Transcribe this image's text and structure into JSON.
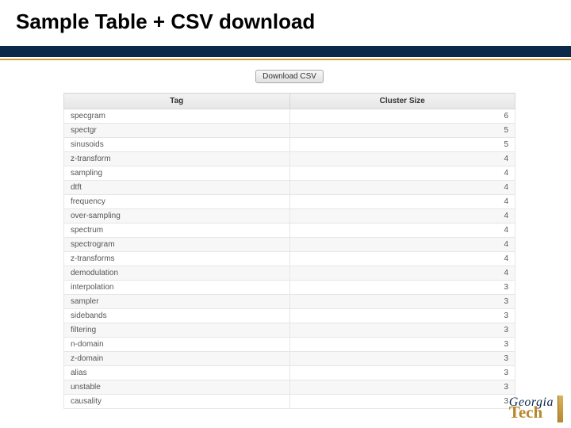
{
  "title": "Sample Table + CSV download",
  "button_label": "Download CSV",
  "columns": {
    "tag": "Tag",
    "size": "Cluster Size"
  },
  "rows": [
    {
      "tag": "specgram",
      "size": 6
    },
    {
      "tag": "spectgr",
      "size": 5
    },
    {
      "tag": "sinusoids",
      "size": 5
    },
    {
      "tag": "z-transform",
      "size": 4
    },
    {
      "tag": "sampling",
      "size": 4
    },
    {
      "tag": "dtft",
      "size": 4
    },
    {
      "tag": "frequency",
      "size": 4
    },
    {
      "tag": "over-sampling",
      "size": 4
    },
    {
      "tag": "spectrum",
      "size": 4
    },
    {
      "tag": "spectrogram",
      "size": 4
    },
    {
      "tag": "z-transforms",
      "size": 4
    },
    {
      "tag": "demodulation",
      "size": 4
    },
    {
      "tag": "interpolation",
      "size": 3
    },
    {
      "tag": "sampler",
      "size": 3
    },
    {
      "tag": "sidebands",
      "size": 3
    },
    {
      "tag": "filtering",
      "size": 3
    },
    {
      "tag": "n-domain",
      "size": 3
    },
    {
      "tag": "z-domain",
      "size": 3
    },
    {
      "tag": "alias",
      "size": 3
    },
    {
      "tag": "unstable",
      "size": 3
    },
    {
      "tag": "causality",
      "size": 3
    }
  ],
  "logo": {
    "line1": "Georgia",
    "line2": "Tech"
  },
  "chart_data": {
    "type": "table",
    "columns": [
      "Tag",
      "Cluster Size"
    ],
    "rows": [
      [
        "specgram",
        6
      ],
      [
        "spectgr",
        5
      ],
      [
        "sinusoids",
        5
      ],
      [
        "z-transform",
        4
      ],
      [
        "sampling",
        4
      ],
      [
        "dtft",
        4
      ],
      [
        "frequency",
        4
      ],
      [
        "over-sampling",
        4
      ],
      [
        "spectrum",
        4
      ],
      [
        "spectrogram",
        4
      ],
      [
        "z-transforms",
        4
      ],
      [
        "demodulation",
        4
      ],
      [
        "interpolation",
        3
      ],
      [
        "sampler",
        3
      ],
      [
        "sidebands",
        3
      ],
      [
        "filtering",
        3
      ],
      [
        "n-domain",
        3
      ],
      [
        "z-domain",
        3
      ],
      [
        "alias",
        3
      ],
      [
        "unstable",
        3
      ],
      [
        "causality",
        3
      ]
    ]
  }
}
